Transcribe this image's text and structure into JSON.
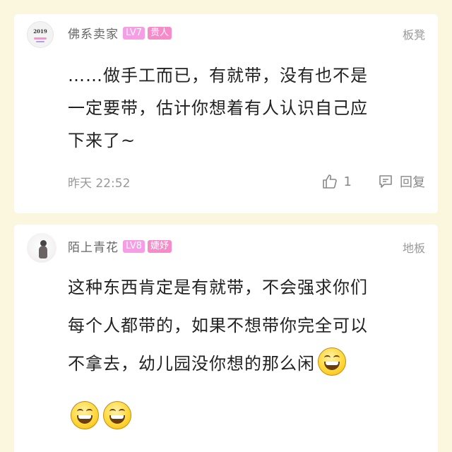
{
  "comments": [
    {
      "username": "佛系卖家",
      "level": "LV7",
      "title": "贵人",
      "floor": "板凳",
      "avatar_text": "2019",
      "content_lines": [
        "……做手工而已，有就带，没有也不是",
        "一定要带，估计你想着有人认识自己应",
        "下来了~"
      ],
      "time": "昨天 22:52",
      "like_count": "1",
      "reply_label": "回复",
      "icons": {
        "like": "thumbs-up-icon",
        "reply": "comment-bubble-icon"
      }
    },
    {
      "username": "陌上青花",
      "level": "LV8",
      "title": "婕妤",
      "floor": "地板",
      "content_lines": [
        "这种东西肯定是有就带，不会强求你们",
        "每个人都带的，如果不想带你完全可以",
        "不拿去，幼儿园没你想的那么闲"
      ],
      "emojis": [
        "grinning-face-emoji",
        "grinning-face-emoji",
        "grinning-face-emoji"
      ]
    }
  ],
  "colors": {
    "background": "#fbf7df",
    "level_badge": "#f59ee6",
    "title_badge": "#f58cc9",
    "muted_text": "#999999"
  }
}
